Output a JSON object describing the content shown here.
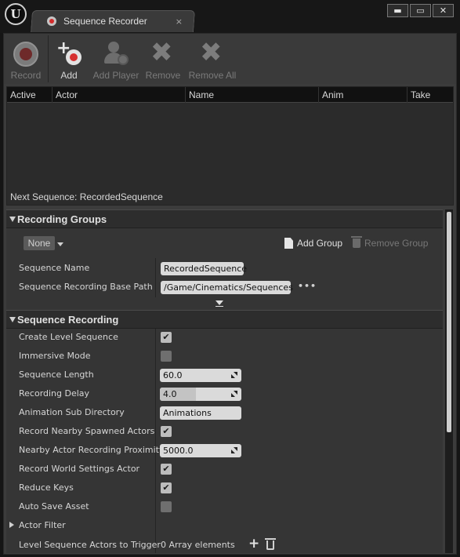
{
  "app": {
    "logo_text": "U",
    "tab_title": "Sequence Recorder",
    "tab_close": "×",
    "window_controls": {
      "minimize": "▬",
      "maximize": "▭",
      "close": "✕"
    }
  },
  "toolbar": {
    "record": "Record",
    "add": "Add",
    "add_player": "Add Player",
    "remove": "Remove",
    "remove_all": "Remove All"
  },
  "actor_list": {
    "columns": [
      "Active",
      "Actor",
      "Name",
      "Anim",
      "Take"
    ],
    "next_sequence": "Next Sequence: RecordedSequence"
  },
  "recording_groups": {
    "title": "Recording Groups",
    "group_select": "None",
    "add_group": "Add Group",
    "remove_group": "Remove Group",
    "sequence_name_label": "Sequence Name",
    "sequence_name_value": "RecordedSequence",
    "base_path_label": "Sequence Recording Base Path",
    "base_path_value": "/Game/Cinematics/Sequences",
    "browse": "•••"
  },
  "sequence_recording": {
    "title": "Sequence Recording",
    "check_mark": "✔",
    "rows": {
      "create_level_sequence": {
        "label": "Create Level Sequence",
        "checked": true
      },
      "immersive_mode": {
        "label": "Immersive Mode",
        "checked": false
      },
      "sequence_length": {
        "label": "Sequence Length",
        "value": "60.0"
      },
      "recording_delay": {
        "label": "Recording Delay",
        "value": "4.0"
      },
      "animation_sub_directory": {
        "label": "Animation Sub Directory",
        "value": "Animations"
      },
      "record_nearby_spawned_actors": {
        "label": "Record Nearby Spawned Actors",
        "checked": true
      },
      "nearby_actor_recording_proximity": {
        "label": "Nearby Actor Recording Proximity",
        "value": "5000.0"
      },
      "record_world_settings_actor": {
        "label": "Record World Settings Actor",
        "checked": true
      },
      "reduce_keys": {
        "label": "Reduce Keys",
        "checked": true
      },
      "auto_save_asset": {
        "label": "Auto Save Asset",
        "checked": false
      },
      "actor_filter": {
        "label": "Actor Filter"
      },
      "level_sequence_actors_to_trigger": {
        "label": "Level Sequence Actors to Trigger",
        "value": "0 Array elements"
      }
    },
    "add_element": "+"
  }
}
